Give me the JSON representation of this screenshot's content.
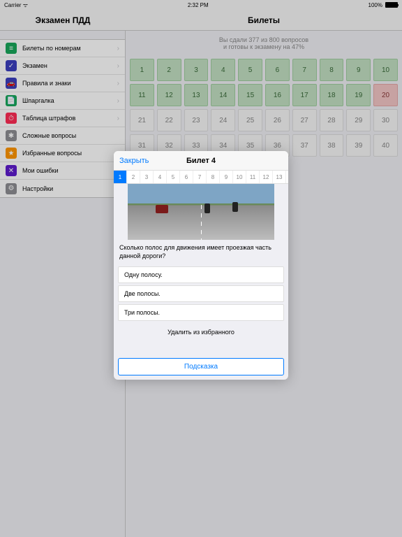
{
  "status": {
    "carrier": "Carrier",
    "time": "2:32 PM",
    "battery": "100%"
  },
  "nav": {
    "left_title": "Экзамен ПДД",
    "right_title": "Билеты"
  },
  "sidebar": {
    "items": [
      {
        "label": "Билеты по номерам",
        "chev": true,
        "bg": "#19a85b",
        "glyph": "≡"
      },
      {
        "label": "Экзамен",
        "chev": true,
        "bg": "#3b3fbf",
        "glyph": "✓"
      },
      {
        "label": "Правила и знаки",
        "chev": true,
        "bg": "#3b3fbf",
        "glyph": "🚗"
      },
      {
        "label": "Шпаргалка",
        "chev": true,
        "bg": "#19a85b",
        "glyph": "📄"
      },
      {
        "label": "Таблица штрафов",
        "chev": true,
        "bg": "#ff2d55",
        "glyph": "⏱"
      },
      {
        "label": "Сложные вопросы",
        "chev": false,
        "bg": "#8e8e93",
        "glyph": "✱"
      },
      {
        "label": "Избранные вопросы",
        "chev": false,
        "bg": "#ff9500",
        "glyph": "★"
      },
      {
        "label": "Мои ошибки",
        "chev": false,
        "bg": "#5e1bce",
        "glyph": "✕"
      },
      {
        "label": "Настройки",
        "chev": false,
        "bg": "#8e8e93",
        "glyph": "⚙"
      }
    ]
  },
  "progress": {
    "line1": "Вы сдали 377 из 800 вопросов",
    "line2": "и готовы к экзамену на 47%"
  },
  "tickets": [
    [
      {
        "n": "1",
        "s": "green"
      },
      {
        "n": "2",
        "s": "green"
      },
      {
        "n": "3",
        "s": "green"
      },
      {
        "n": "4",
        "s": "green"
      },
      {
        "n": "5",
        "s": "green"
      },
      {
        "n": "6",
        "s": "green"
      },
      {
        "n": "7",
        "s": "green"
      },
      {
        "n": "8",
        "s": "green"
      },
      {
        "n": "9",
        "s": "green"
      },
      {
        "n": "10",
        "s": "green"
      }
    ],
    [
      {
        "n": "11",
        "s": "green"
      },
      {
        "n": "12",
        "s": "green"
      },
      {
        "n": "13",
        "s": "green"
      },
      {
        "n": "14",
        "s": "green"
      },
      {
        "n": "15",
        "s": "green"
      },
      {
        "n": "16",
        "s": "green"
      },
      {
        "n": "17",
        "s": "green"
      },
      {
        "n": "18",
        "s": "green"
      },
      {
        "n": "19",
        "s": "green"
      },
      {
        "n": "20",
        "s": "red"
      }
    ],
    [
      {
        "n": "21",
        "s": "gray"
      },
      {
        "n": "22",
        "s": "gray"
      },
      {
        "n": "23",
        "s": "gray"
      },
      {
        "n": "24",
        "s": "gray"
      },
      {
        "n": "25",
        "s": "gray"
      },
      {
        "n": "26",
        "s": "gray"
      },
      {
        "n": "27",
        "s": "gray"
      },
      {
        "n": "28",
        "s": "gray"
      },
      {
        "n": "29",
        "s": "gray"
      },
      {
        "n": "30",
        "s": "gray"
      }
    ],
    [
      {
        "n": "31",
        "s": "gray"
      },
      {
        "n": "32",
        "s": "gray"
      },
      {
        "n": "33",
        "s": "gray"
      },
      {
        "n": "34",
        "s": "gray"
      },
      {
        "n": "35",
        "s": "gray"
      },
      {
        "n": "36",
        "s": "gray"
      },
      {
        "n": "37",
        "s": "gray"
      },
      {
        "n": "38",
        "s": "gray"
      },
      {
        "n": "39",
        "s": "gray"
      },
      {
        "n": "40",
        "s": "gray"
      }
    ]
  ],
  "modal": {
    "close": "Закрыть",
    "title": "Билет 4",
    "qnums": [
      "1",
      "2",
      "3",
      "4",
      "5",
      "6",
      "7",
      "8",
      "9",
      "10",
      "11",
      "12",
      "13"
    ],
    "selected": 0,
    "question": "Сколько полос для движения имеет проезжая часть данной дороги?",
    "answers": [
      "Одну полосу.",
      "Две полосы.",
      "Три полосы."
    ],
    "remove": "Удалить из избранного",
    "hint": "Подсказка"
  }
}
